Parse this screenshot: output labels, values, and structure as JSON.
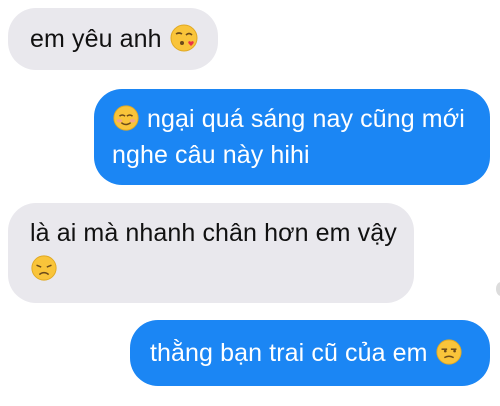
{
  "conversation": {
    "messages": [
      {
        "direction": "incoming",
        "lines": [
          "em yêu anh"
        ],
        "emoji": "face-blowing-kiss-icon"
      },
      {
        "direction": "outgoing",
        "lines": [
          "ngại quá sáng nay cũng mới",
          "nghe câu này hihi"
        ],
        "emoji": "smiling-face-icon"
      },
      {
        "direction": "incoming",
        "lines": [
          "là ai mà nhanh chân hơn em vậy"
        ],
        "emoji": "disappointed-face-icon"
      },
      {
        "direction": "outgoing",
        "lines": [
          "thằng bạn trai cũ của em"
        ],
        "emoji": "unamused-face-icon"
      }
    ]
  },
  "colors": {
    "incoming_bubble": "#e9e8ed",
    "outgoing_bubble": "#1b86f4",
    "incoming_text": "#111111",
    "outgoing_text": "#ffffff",
    "emoji_yellow": "#f9c43a"
  }
}
